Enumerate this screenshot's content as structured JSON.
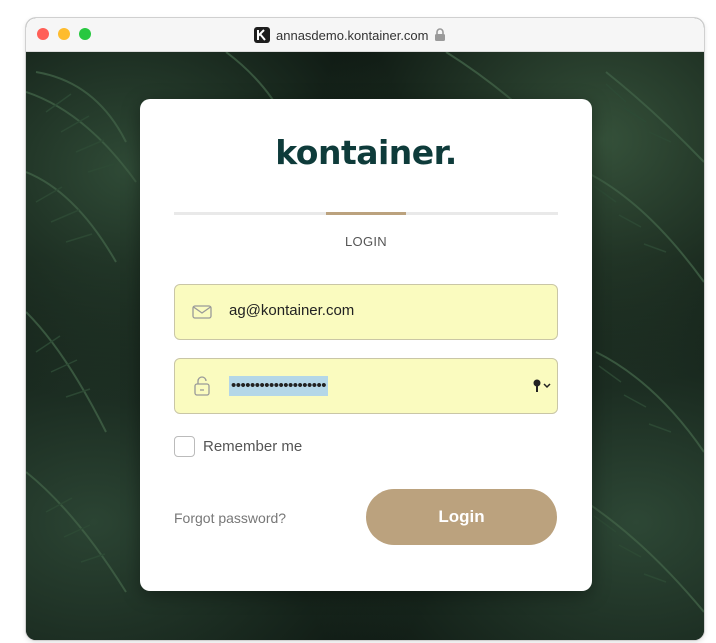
{
  "browser": {
    "url": "annasdemo.kontainer.com",
    "favicon_icon": "kontainer-k-icon",
    "lock_icon": "lock-icon"
  },
  "card": {
    "logo_text": "kontainer.",
    "tab_label": "LOGIN"
  },
  "form": {
    "email_value": "ag@kontainer.com",
    "email_icon": "envelope-icon",
    "password_value": "••••••••••••••••••••",
    "password_icon": "unlock-icon",
    "password_manager_icon": "key-dropdown-icon",
    "remember_label": "Remember me",
    "remember_checked": false,
    "forgot_label": "Forgot password?",
    "login_label": "Login"
  },
  "colors": {
    "accent": "#bba27e",
    "brand": "#0e3b3a",
    "autofill": "#fafbbf"
  }
}
